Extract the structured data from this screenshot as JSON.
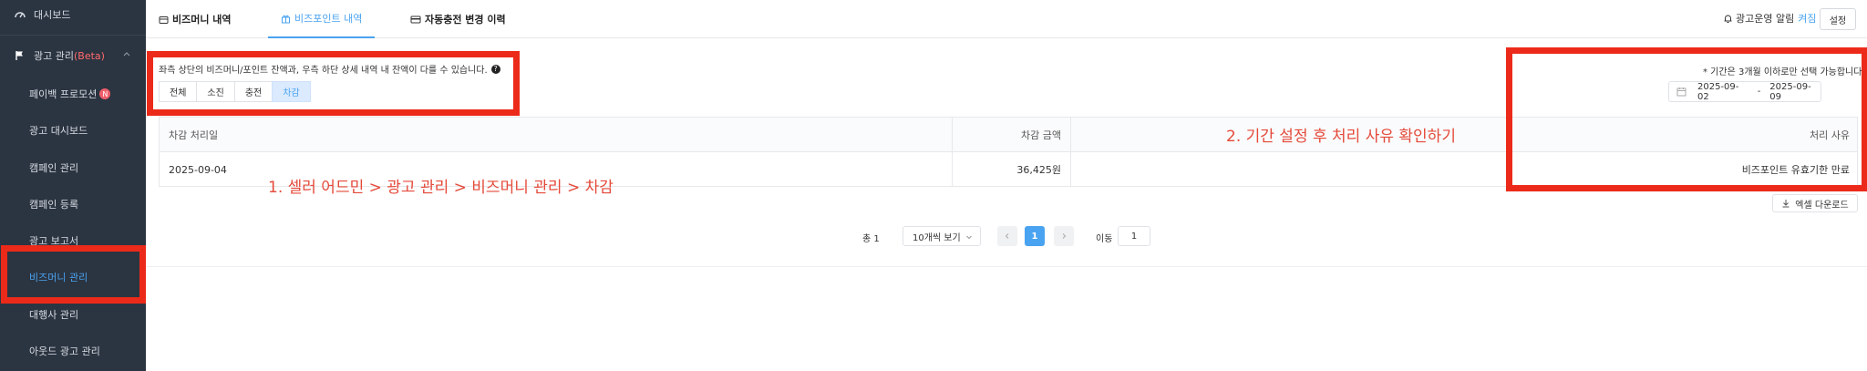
{
  "sidebar": {
    "items": [
      {
        "label": "대시보드"
      },
      {
        "label": "광고 관리",
        "suffix": "(Beta)"
      },
      {
        "label": "페이백 프로모션",
        "badge": "N"
      },
      {
        "label": "광고 대시보드"
      },
      {
        "label": "캠페인 관리"
      },
      {
        "label": "캠페인 등록"
      },
      {
        "label": "광고 보고서"
      },
      {
        "label": "비즈머니 관리"
      },
      {
        "label": "대행사 관리"
      },
      {
        "label": "아웃드 광고 관리"
      }
    ]
  },
  "tabs": [
    {
      "label": "비즈머니 내역"
    },
    {
      "label": "비즈포인트 내역"
    },
    {
      "label": "자동충전 변경 이력"
    }
  ],
  "header": {
    "alert_label": "광고운영 알림",
    "alert_state": "켜짐",
    "settings_label": "설정"
  },
  "description": "좌측 상단의 비즈머니/포인트 잔액과, 우측 하단 상세 내역 내 잔액이 다를 수 있습니다.",
  "help_glyph": "?",
  "filters": [
    "전체",
    "소진",
    "충전",
    "차감"
  ],
  "period_note": "* 기간은 3개월 이하로만 선택 가능합니다.",
  "date_range": {
    "start": "2025-09-02",
    "sep": "-",
    "end": "2025-09-09"
  },
  "table": {
    "headers": [
      "차감 처리일",
      "차감 금액",
      "처리 사유"
    ],
    "rows": [
      {
        "date": "2025-09-04",
        "amount": "36,425원",
        "reason": "비즈포인트 유효기한 만료"
      }
    ]
  },
  "excel_label": "엑셀 다운로드",
  "pagination": {
    "total": "총 1",
    "per_page": "10개씩 보기",
    "current_page": "1",
    "move_label": "이동",
    "move_value": "1"
  },
  "annotations": {
    "step1": "1. 셀러 어드민 > 광고 관리 > 비즈머니 관리 > 차감",
    "step2": "2. 기간 설정 후 처리 사유 확인하기"
  },
  "colors": {
    "accent": "#4aa3f0",
    "annotation": "#ec2a1a",
    "sidebar_bg": "#2b3441"
  },
  "icons": [
    "dashboard-icon",
    "flag-icon",
    "chevron-up-icon",
    "wallet-icon",
    "gift-icon",
    "card-icon",
    "bell-icon",
    "help-icon",
    "calendar-icon",
    "download-icon",
    "chevron-down-icon",
    "chevron-left-icon",
    "chevron-right-icon"
  ]
}
